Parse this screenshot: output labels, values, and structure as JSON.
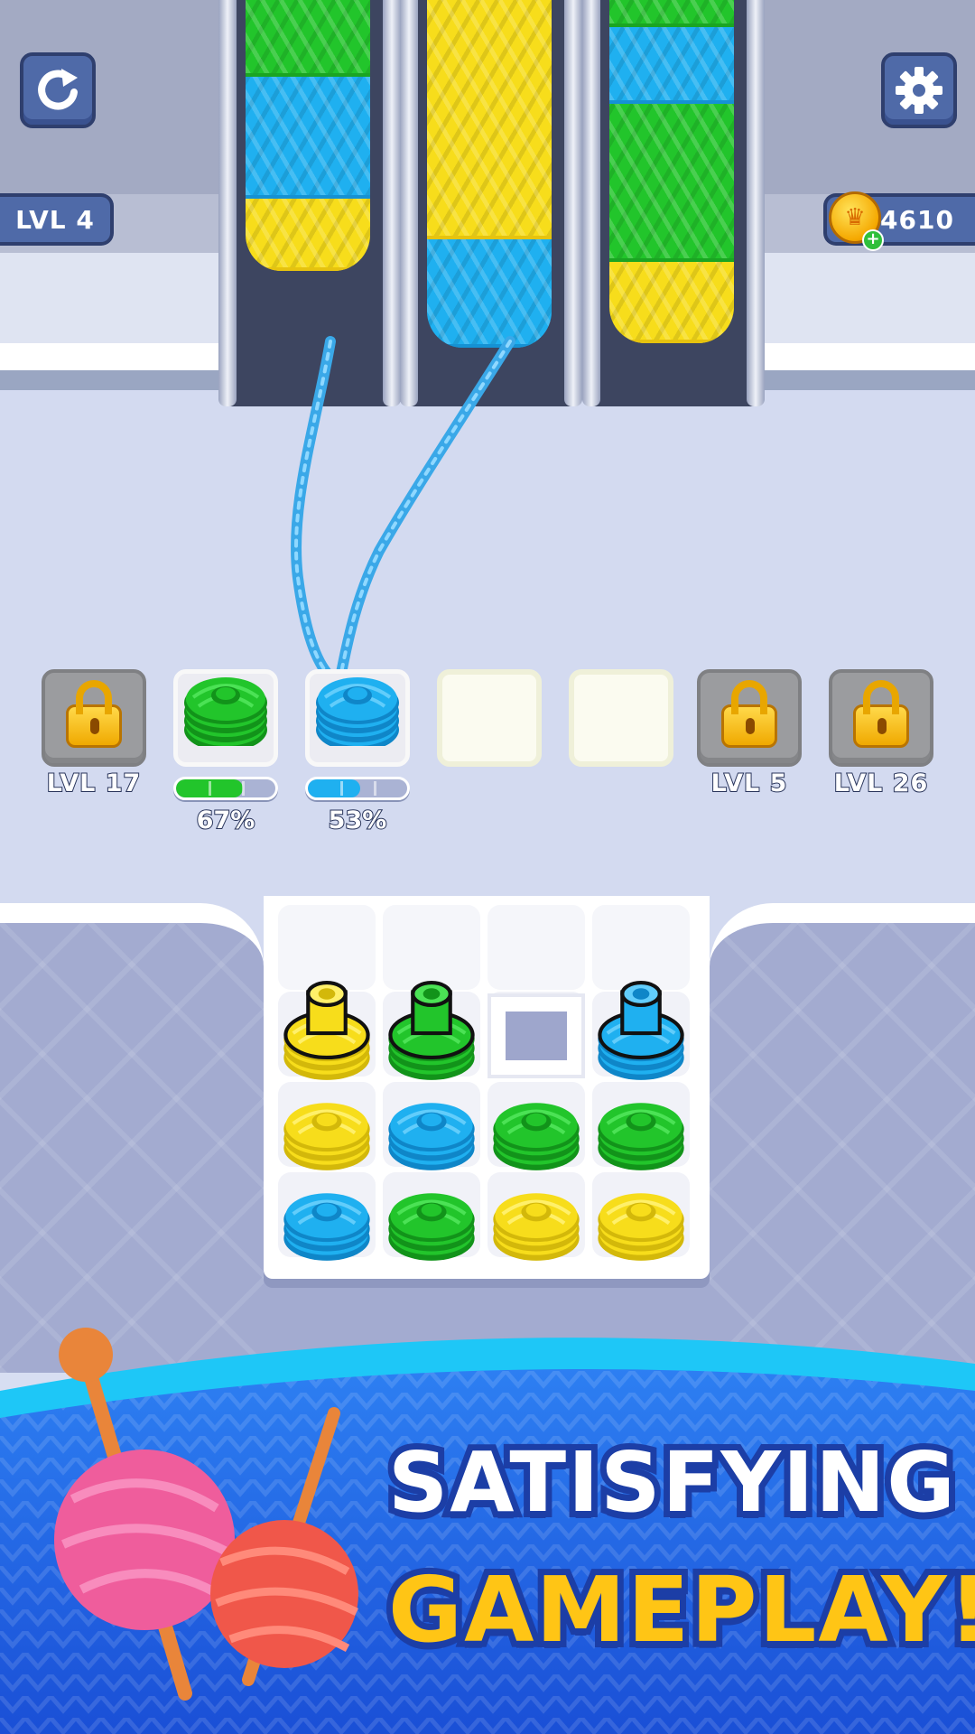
{
  "hud": {
    "level_label": "LVL 4",
    "coins": "4610",
    "restart_icon": "restart-icon",
    "settings_icon": "gear-icon"
  },
  "colors": {
    "green": "#22c52b",
    "blue": "#1fb0f0",
    "yellow": "#f7dd1b",
    "ui_blue": "#4f6aa8",
    "banner_blue": "#1c5ee0"
  },
  "conveyors": [
    {
      "bands": [
        {
          "color": "green",
          "units": 85
        },
        {
          "color": "blue",
          "units": 135
        },
        {
          "color": "yellow",
          "units": 80
        }
      ]
    },
    {
      "bands": [
        {
          "color": "yellow",
          "units": 265
        },
        {
          "color": "blue",
          "units": 120
        }
      ]
    },
    {
      "bands": [
        {
          "color": "green",
          "units": 30
        },
        {
          "color": "blue",
          "units": 85
        },
        {
          "color": "green",
          "units": 175
        },
        {
          "color": "yellow",
          "units": 90
        }
      ]
    }
  ],
  "slots": [
    {
      "state": "locked",
      "caption": "LVL 17"
    },
    {
      "state": "filled",
      "spool_color": "green",
      "progress": 0.67,
      "progress_label": "67%"
    },
    {
      "state": "filled",
      "spool_color": "blue",
      "progress": 0.53,
      "progress_label": "53%"
    },
    {
      "state": "empty"
    },
    {
      "state": "empty"
    },
    {
      "state": "locked",
      "caption": "LVL 5"
    },
    {
      "state": "locked",
      "caption": "LVL 26"
    }
  ],
  "board": {
    "rows": [
      [
        "empty",
        "empty",
        "empty",
        "empty"
      ],
      [
        "yellow-top",
        "green-top",
        "hole",
        "blue-top"
      ],
      [
        "yellow",
        "blue",
        "green",
        "green"
      ],
      [
        "blue",
        "green",
        "yellow",
        "yellow"
      ]
    ]
  },
  "banner": {
    "line1": "SATISFYING",
    "line2": "GAMEPLAY!"
  }
}
